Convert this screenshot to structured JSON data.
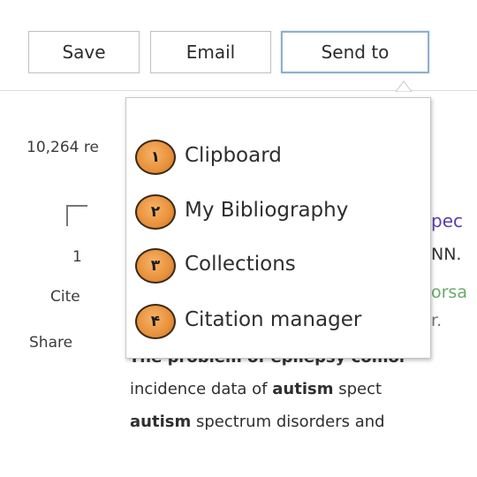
{
  "toolbar": {
    "save_label": "Save",
    "email_label": "Email",
    "send_to_label": "Send to"
  },
  "results": {
    "count_text": "10,264 re"
  },
  "result_item": {
    "number": "1",
    "cite_label": "Cite",
    "share_label": "Share",
    "title_peek": "pec",
    "author_peek": "NN.",
    "journal_peek": "orsa",
    "year_peek": "r.",
    "abstract_cut_line": "The problem of epilepsy comor",
    "abstract_line2": {
      "before": "incidence data of ",
      "bold": "autism",
      "after": " spect"
    },
    "abstract_line3": {
      "bold": "autism",
      "after": " spectrum disorders and"
    }
  },
  "send_to_menu": {
    "items": [
      {
        "badge": "١",
        "label": "Clipboard"
      },
      {
        "badge": "٢",
        "label": "My Bibliography"
      },
      {
        "badge": "٣",
        "label": "Collections"
      },
      {
        "badge": "۴",
        "label": "Citation manager"
      }
    ]
  },
  "colors": {
    "badge_orange": "#e8913a",
    "title_purple": "#5a3fa8",
    "journal_green": "#6aa96a",
    "active_border": "#8fb0cf"
  }
}
